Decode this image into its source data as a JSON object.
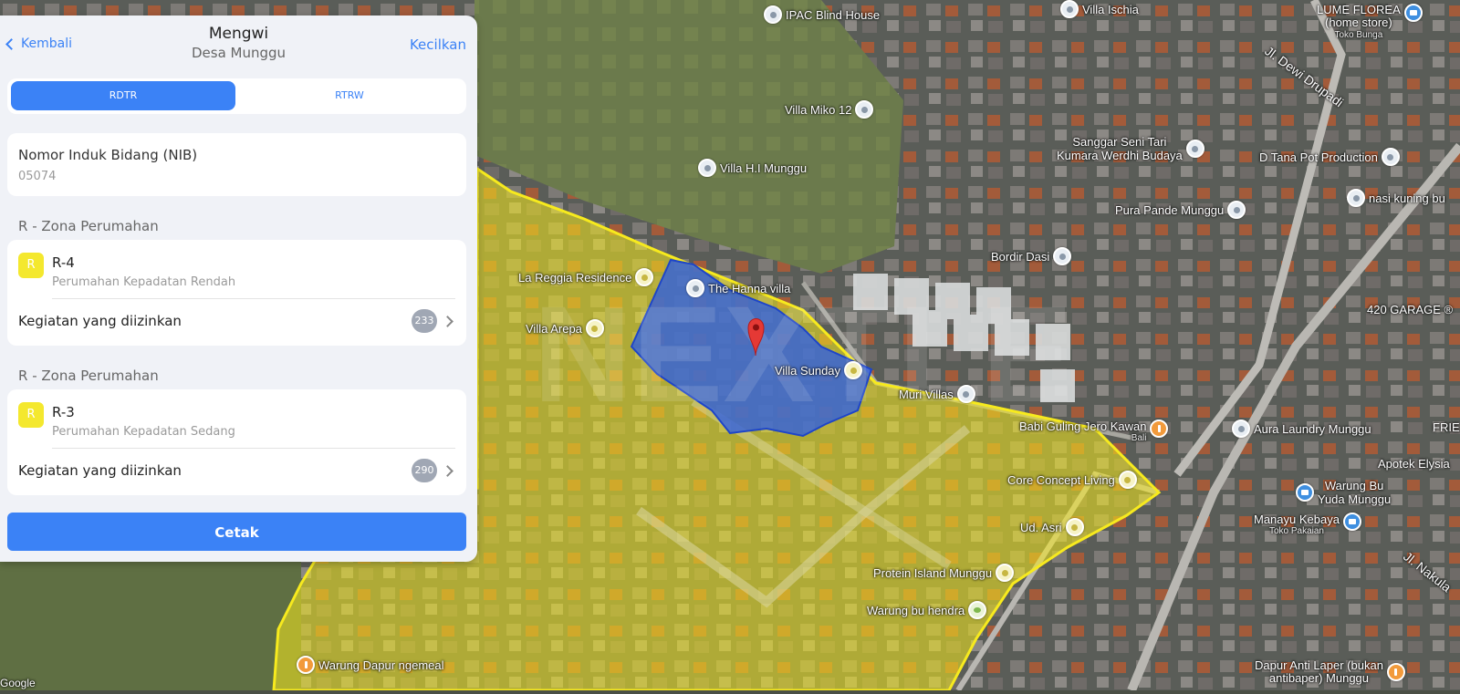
{
  "panel": {
    "back_label": "Kembali",
    "title": "Mengwi",
    "subtitle": "Desa Munggu",
    "minimize_label": "Kecilkan",
    "tabs": [
      {
        "label": "RDTR",
        "active": true
      },
      {
        "label": "RTRW",
        "active": false
      }
    ],
    "nib": {
      "label": "Nomor Induk Bidang (NIB)",
      "value": "05074"
    },
    "zones": [
      {
        "heading": "R - Zona Perumahan",
        "badge": "R",
        "code": "R-4",
        "description": "Perumahan Kepadatan Rendah",
        "activity_label": "Kegiatan yang diizinkan",
        "count": "233"
      },
      {
        "heading": "R - Zona Perumahan",
        "badge": "R",
        "code": "R-3",
        "description": "Perumahan Kepadatan Sedang",
        "activity_label": "Kegiatan yang diizinkan",
        "count": "290"
      }
    ],
    "print_label": "Cetak"
  },
  "map": {
    "colors": {
      "zone_fill": "#f5ea1e",
      "parcel_fill": "#2f5fe0",
      "marker": "#e53935",
      "accent": "#3b82f6"
    },
    "places": [
      {
        "name": "IPAC Blind House",
        "icon": "pin-icon"
      },
      {
        "name": "Villa Ischia",
        "icon": "pin-icon"
      },
      {
        "name": "LUME FLOREA",
        "sub": "(home store)",
        "extra": "Toko Bunga",
        "icon": "shop-icon"
      },
      {
        "name": "Villa Miko 12",
        "icon": "pin-icon"
      },
      {
        "name": "Villa H.I Munggu",
        "icon": "pin-icon"
      },
      {
        "name": "Sanggar Seni Tari",
        "sub": "Kumara Werdhi Budaya",
        "icon": "pin-icon"
      },
      {
        "name": "D Tana Pot Production",
        "icon": "pin-icon"
      },
      {
        "name": "Pura Pande Munggu",
        "icon": "pin-icon"
      },
      {
        "name": "nasi kuning bu",
        "icon": "pin-icon"
      },
      {
        "name": "Bordir Dasi",
        "icon": "pin-icon"
      },
      {
        "name": "La Reggia Residence",
        "icon": "pin-icon"
      },
      {
        "name": "The Hanna villa",
        "icon": "pin-icon"
      },
      {
        "name": "Villa Arepa",
        "icon": "pin-icon"
      },
      {
        "name": "420 GARAGE ®",
        "icon": "pin-icon"
      },
      {
        "name": "Villa Sunday",
        "icon": "pin-icon"
      },
      {
        "name": "Muri Villas",
        "icon": "pin-icon"
      },
      {
        "name": "Babi Guling Jero Kawan",
        "extra": "Bali",
        "icon": "food-icon"
      },
      {
        "name": "Aura Laundry Munggu",
        "icon": "pin-icon"
      },
      {
        "name": "FRIE",
        "icon": "pin-icon"
      },
      {
        "name": "Apotek Elysia",
        "icon": "pin-icon"
      },
      {
        "name": "Warung Bu",
        "sub": "Yuda Munggu",
        "icon": "shop-icon"
      },
      {
        "name": "Core Concept Living",
        "icon": "pin-icon"
      },
      {
        "name": "Manayu Kebaya",
        "extra": "Toko Pakaian",
        "icon": "shop-icon"
      },
      {
        "name": "Ud. Asri",
        "icon": "shop-icon"
      },
      {
        "name": "Protein Island Munggu",
        "icon": "pin-icon"
      },
      {
        "name": "Warung bu hendra",
        "icon": "shop-icon"
      },
      {
        "name": "Warung Dapur ngemeal",
        "icon": "food-icon"
      },
      {
        "name": "Dapur Anti Laper (bukan",
        "sub": "antibaper) Munggu",
        "icon": "food-icon"
      }
    ],
    "roads": [
      "Jl. Dewi Drupadi",
      "Jl. Nakula"
    ],
    "attribution": "Google"
  }
}
